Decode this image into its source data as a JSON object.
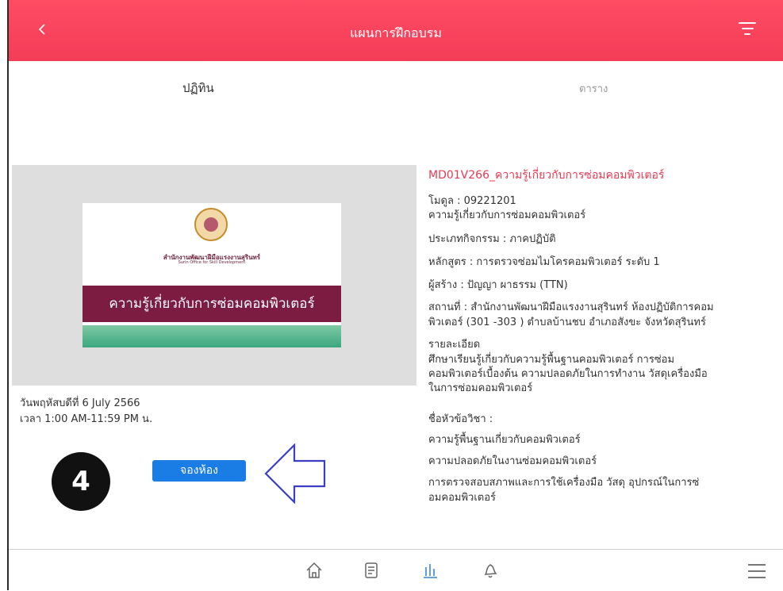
{
  "header": {
    "title": "แผนการฝึกอบรม",
    "back_icon": "chevron-left-icon",
    "filter_icon": "filter-icon"
  },
  "tabs": [
    {
      "label": "ปฏิทิน"
    },
    {
      "label": "ตาราง"
    }
  ],
  "course_image": {
    "org_thai": "สำนักงานพัฒนาฝีมือแรงงานสุรินทร์",
    "org_english": "Surin Office for Skill Development",
    "banner_text": "ความรู้เกี่ยวกับการซ่อมคอมพิวเตอร์"
  },
  "schedule": {
    "date": "วันพฤหัสบดีที่ 6 July 2566",
    "time": "เวลา 1:00 AM-11:59 PM น."
  },
  "annotation": {
    "badge": "4"
  },
  "book_button": "จองห้อง",
  "details": {
    "code_title": "MD01V266_ความรู้เกี่ยวกับการซ่อมคอมพิวเตอร์",
    "module": "โมดูล : 09221201",
    "module_name": "ความรู้เกี่ยวกับการซ่อมคอมพิวเตอร์",
    "activity_type": "ประเภทกิจกรรม : ภาคปฏิบัติ",
    "curriculum": "หลักสูตร : การตรวจซ่อมไมโครคอมพิวเตอร์ ระดับ 1",
    "creator": "ผู้สร้าง : ปัญญา ผาธรรม (TTN)",
    "location_1": "สถานที่ : สำนักงานพัฒนาฝีมือแรงงานสุรินทร์ ห้องปฏิบัติการคอม",
    "location_2": "พิวเตอร์ (301 -303 ) ตำบลบ้านชบ อำเภอสังขะ  จังหวัดสุรินทร์",
    "description_label": "รายละเอียด",
    "description_1": "ศึกษาเรียนรู้เกี่ยวกับความรู้พื้นฐานคอมพิวเตอร์  การซ่อม",
    "description_2": "คอมพิวเตอร์เบื้องต้น  ความปลอดภัยในการทำงาน  วัสดุเครื่องมือ",
    "description_3": "ในการซ่อมคอมพิวเตอร์",
    "subjects_label": "ชื่อหัวข้อวิชา :",
    "subject_1": "ความรู้พื้นฐานเกี่ยวกับคอมพิวเตอร์",
    "subject_2": "ความปลอดภัยในงานซ่อมคอมพิวเตอร์",
    "subject_3a": "การตรวจสอบสภาพและการใช้เครื่องมือ วัสดุ อุปกรณ์ในการซ่",
    "subject_3b": "อมคอมพิวเตอร์"
  },
  "bottom_nav": {
    "icons": [
      "home-icon",
      "document-icon",
      "chart-icon",
      "bell-icon",
      "menu-icon"
    ]
  },
  "colors": {
    "header": "#f43c57",
    "accent_button": "#1a7de6",
    "title_red": "#ea3952",
    "maroon": "#7c1c40",
    "arrow": "#3b3fc4"
  }
}
